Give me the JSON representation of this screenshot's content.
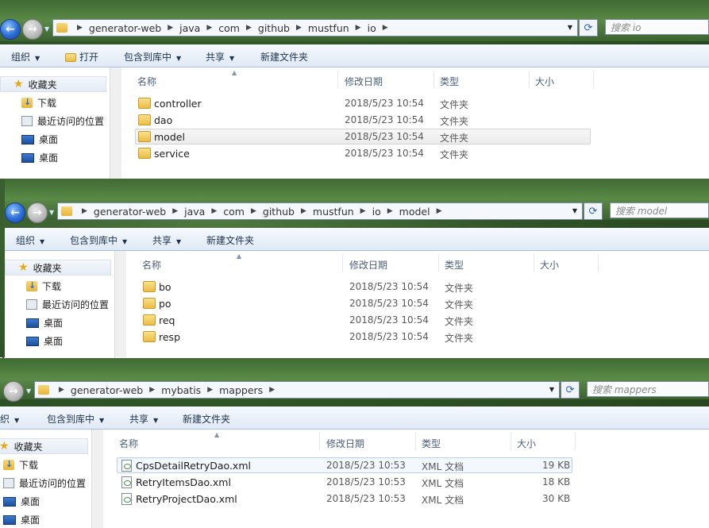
{
  "window1": {
    "breadcrumb": [
      "generator-web",
      "java",
      "com",
      "github",
      "mustfun",
      "io"
    ],
    "search_placeholder": "搜索 io",
    "toolbar": [
      "组织",
      "打开",
      "包含到库中",
      "共享",
      "新建文件夹"
    ],
    "nav": {
      "favorites": "收藏夹",
      "items": [
        "下载",
        "最近访问的位置",
        "桌面",
        "桌面"
      ]
    },
    "columns": [
      "名称",
      "修改日期",
      "类型",
      "大小"
    ],
    "files": [
      {
        "name": "controller",
        "date": "2018/5/23 10:54",
        "type": "文件夹",
        "size": ""
      },
      {
        "name": "dao",
        "date": "2018/5/23 10:54",
        "type": "文件夹",
        "size": ""
      },
      {
        "name": "model",
        "date": "2018/5/23 10:54",
        "type": "文件夹",
        "size": "",
        "selected": true
      },
      {
        "name": "service",
        "date": "2018/5/23 10:54",
        "type": "文件夹",
        "size": ""
      }
    ]
  },
  "window2": {
    "breadcrumb": [
      "generator-web",
      "java",
      "com",
      "github",
      "mustfun",
      "io",
      "model"
    ],
    "search_placeholder": "搜索 model",
    "toolbar": [
      "组织",
      "包含到库中",
      "共享",
      "新建文件夹"
    ],
    "nav": {
      "favorites": "收藏夹",
      "items": [
        "下载",
        "最近访问的位置",
        "桌面",
        "桌面"
      ]
    },
    "columns": [
      "名称",
      "修改日期",
      "类型",
      "大小"
    ],
    "files": [
      {
        "name": "bo",
        "date": "2018/5/23 10:54",
        "type": "文件夹",
        "size": ""
      },
      {
        "name": "po",
        "date": "2018/5/23 10:54",
        "type": "文件夹",
        "size": ""
      },
      {
        "name": "req",
        "date": "2018/5/23 10:54",
        "type": "文件夹",
        "size": ""
      },
      {
        "name": "resp",
        "date": "2018/5/23 10:54",
        "type": "文件夹",
        "size": ""
      }
    ]
  },
  "window3": {
    "breadcrumb": [
      "generator-web",
      "mybatis",
      "mappers"
    ],
    "search_placeholder": "搜索 mappers",
    "toolbar": [
      "织",
      "包含到库中",
      "共享",
      "新建文件夹"
    ],
    "nav": {
      "favorites": "收藏夹",
      "items": [
        "下载",
        "最近访问的位置",
        "桌面",
        "桌面"
      ]
    },
    "columns": [
      "名称",
      "修改日期",
      "类型",
      "大小"
    ],
    "files": [
      {
        "name": "CpsDetailRetryDao.xml",
        "date": "2018/5/23 10:53",
        "type": "XML 文档",
        "size": "19 KB",
        "selected": true
      },
      {
        "name": "RetryItemsDao.xml",
        "date": "2018/5/23 10:53",
        "type": "XML 文档",
        "size": "18 KB"
      },
      {
        "name": "RetryProjectDao.xml",
        "date": "2018/5/23 10:53",
        "type": "XML 文档",
        "size": "30 KB"
      }
    ]
  },
  "icons": {
    "back": "back-arrow-icon",
    "forward": "forward-arrow-icon",
    "refresh": "refresh-icon",
    "folder": "folder-icon",
    "xml": "xml-file-icon",
    "star": "star-icon",
    "download": "download-folder-icon",
    "recent": "recent-places-icon",
    "desktop": "desktop-icon"
  },
  "glyphs": {
    "back": "←",
    "forward": "→",
    "refresh": "⟳",
    "dropdown": "▼",
    "sep": "▶",
    "sort": "▲",
    "star": "★"
  }
}
